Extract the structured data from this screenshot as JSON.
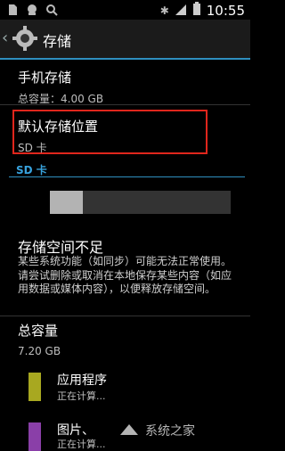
{
  "status_bar": {
    "time": "10:55"
  },
  "action_bar": {
    "title": "存储"
  },
  "internal": {
    "title": "手机存储",
    "total": "总容量：4.00 GB"
  },
  "default_location": {
    "title": "默认存储位置",
    "value": "SD 卡"
  },
  "sd": {
    "header": "SD 卡",
    "used_fraction": 0.18,
    "warning_title": "存储空间不足",
    "warning_text": "某些系统功能（如同步）可能无法正常使用。请尝试删除或取消在本地保存某些内容（如应用数据或媒体内容），以便释放存储空间。",
    "total_label": "总容量",
    "total_value": "7.20 GB",
    "categories": [
      {
        "name": "应用程序",
        "status": "正在计算...",
        "color": "#a8a820"
      },
      {
        "name": "图片、",
        "status": "正在计算...",
        "color": "#8a3fa8"
      }
    ]
  },
  "watermark": "系统之家"
}
